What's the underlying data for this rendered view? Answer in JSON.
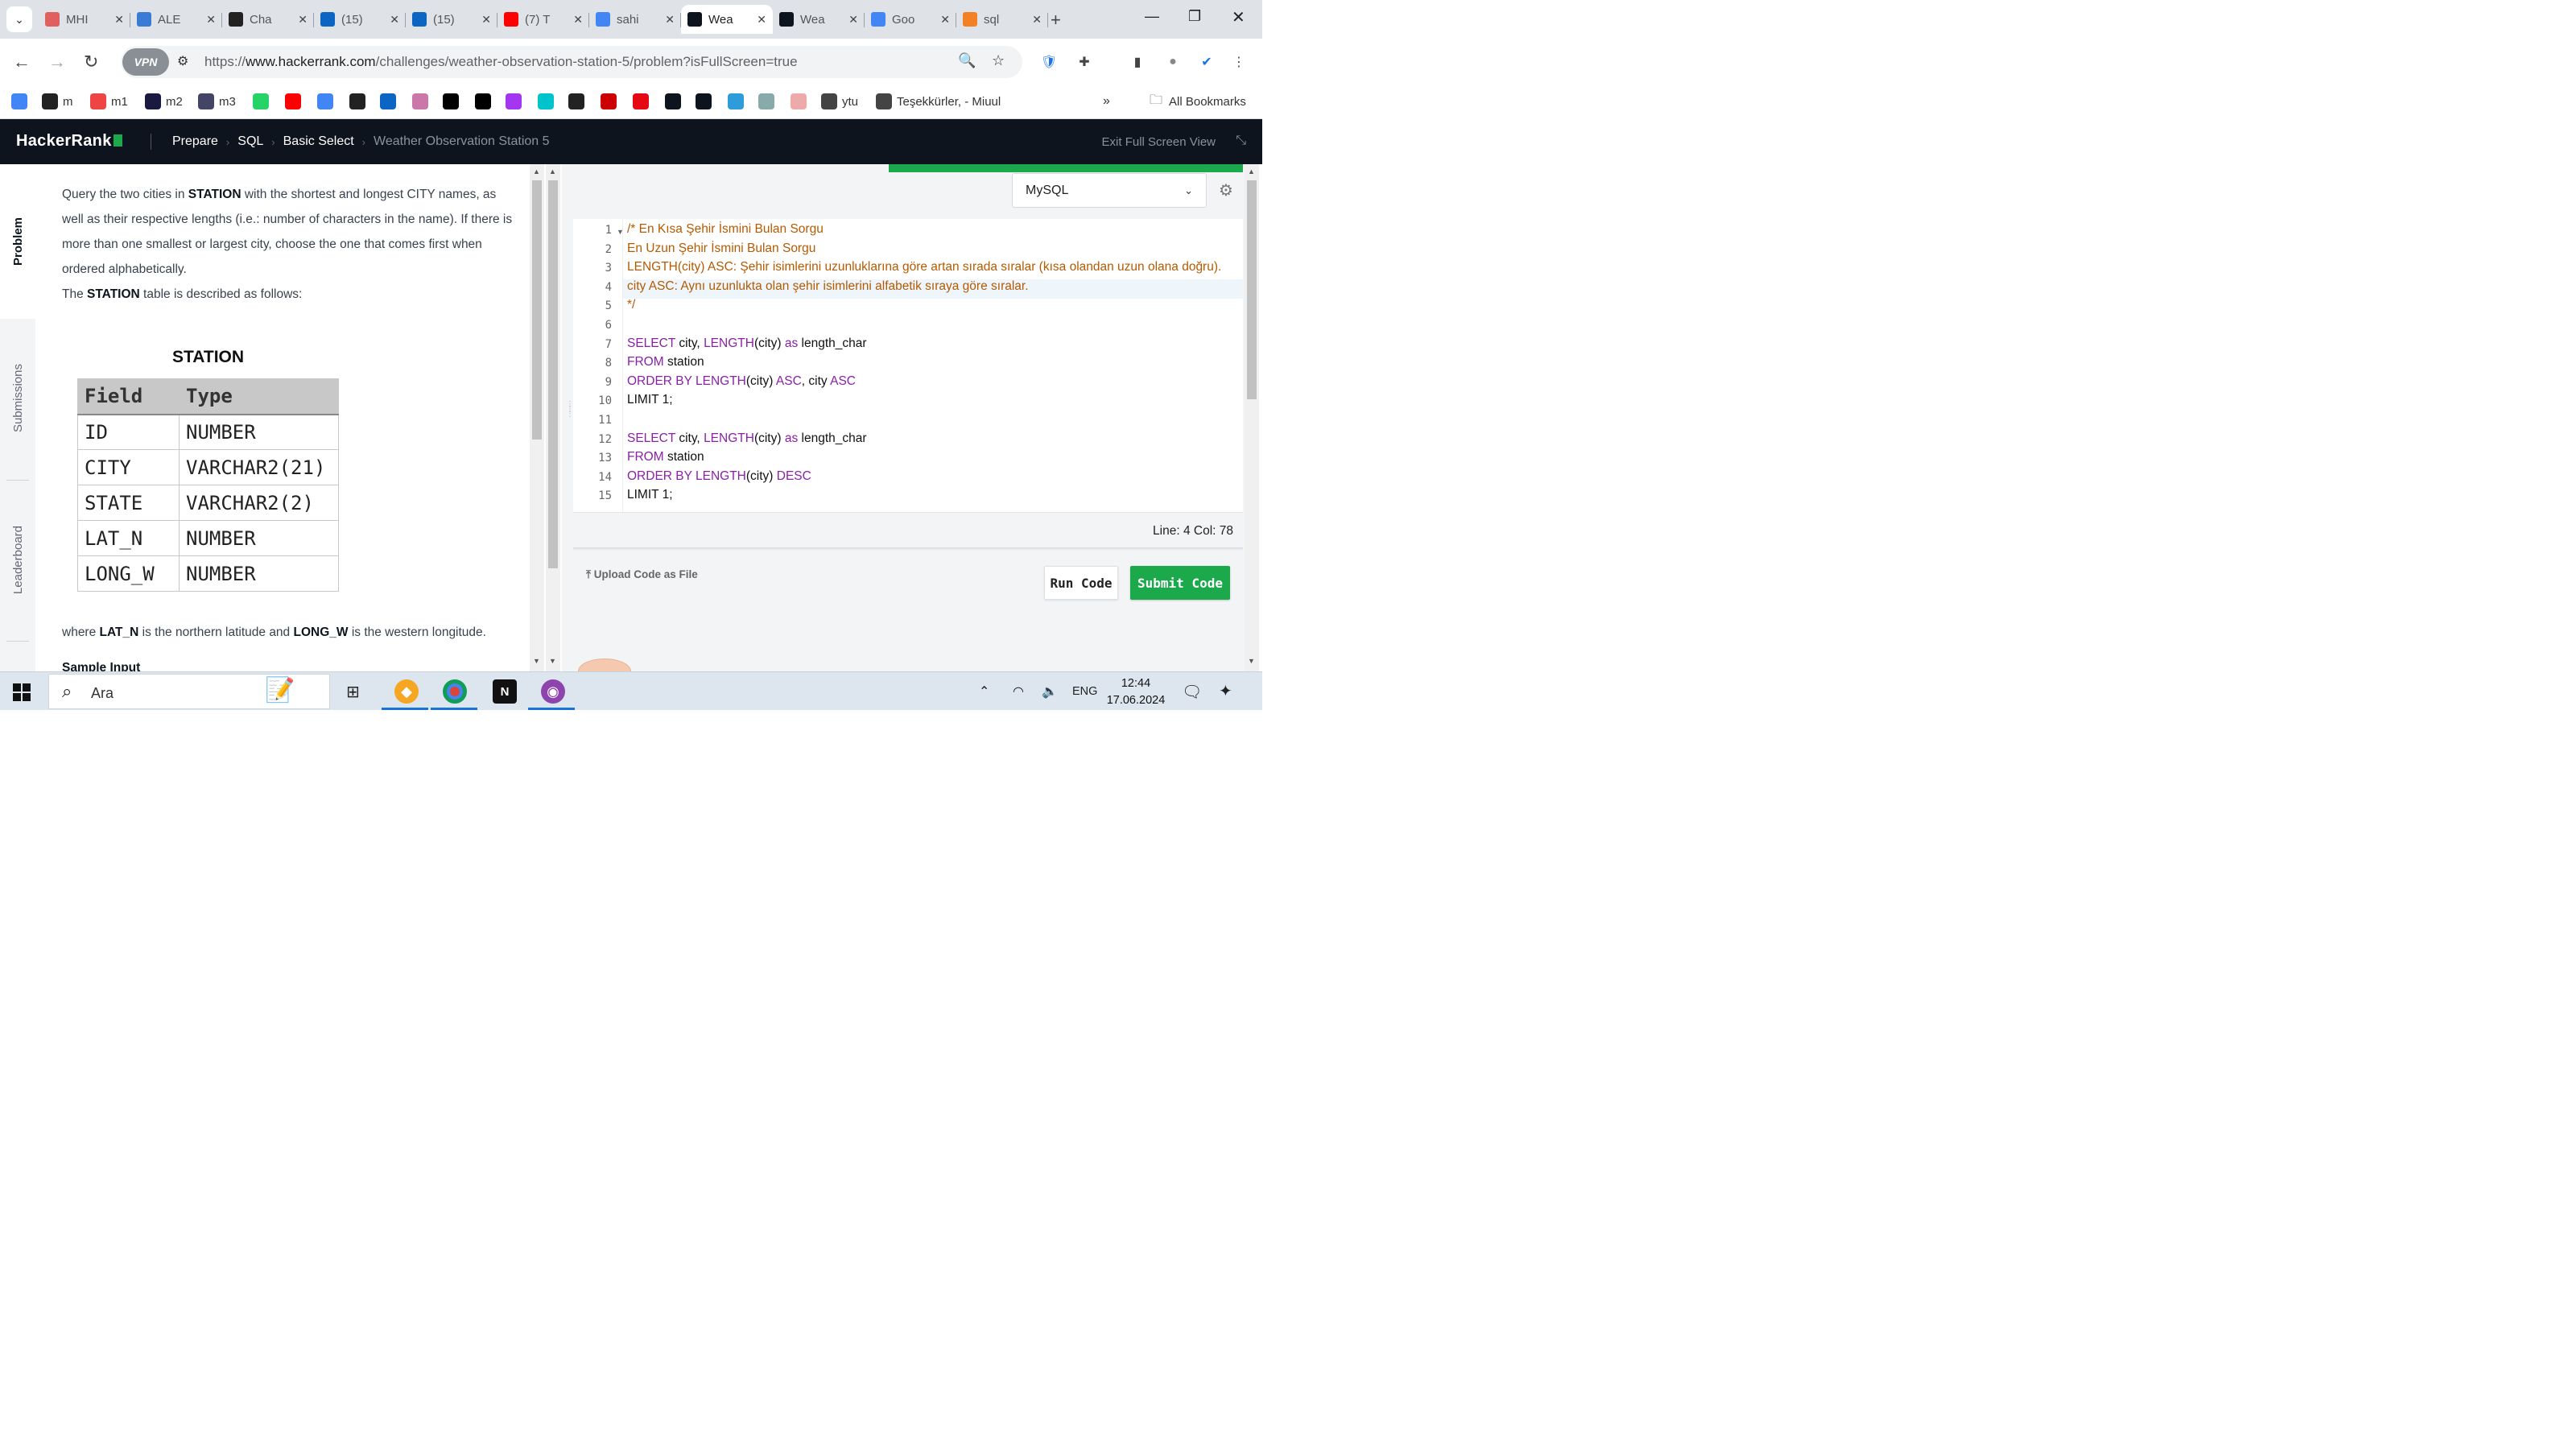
{
  "browser": {
    "tabs": [
      {
        "label": "MHI",
        "icon": "mhi-icon",
        "color": "#e06060"
      },
      {
        "label": "ALE",
        "icon": "alem-icon",
        "color": "#3a7bd5"
      },
      {
        "label": "Cha",
        "icon": "chatgpt-icon",
        "color": "#222222"
      },
      {
        "label": "(15)",
        "icon": "linkedin-icon",
        "color": "#0a66c2"
      },
      {
        "label": "(15)",
        "icon": "linkedin-icon",
        "color": "#0a66c2"
      },
      {
        "label": "(7) T",
        "icon": "youtube-icon",
        "color": "#ff0000"
      },
      {
        "label": "sahi",
        "icon": "google-icon",
        "color": "#4285f4"
      },
      {
        "label": "Wea",
        "icon": "hackerrank-icon",
        "color": "#0e141e",
        "active": true
      },
      {
        "label": "Wea",
        "icon": "hackerrank-icon",
        "color": "#0e141e"
      },
      {
        "label": "Goo",
        "icon": "google-translate-icon",
        "color": "#4285f4"
      },
      {
        "label": "sql",
        "icon": "stackoverflow-icon",
        "color": "#f48024"
      }
    ],
    "url_prefix": "https://",
    "url_host": "www.hackerrank.com",
    "url_path": "/challenges/weather-observation-station-5/problem?isFullScreen=true",
    "vpn_label": "VPN",
    "bookmarks": [
      {
        "label": "",
        "icon": "google-icon"
      },
      {
        "label": "m",
        "icon": "film-reel-icon"
      },
      {
        "label": "m1",
        "icon": "cinema-icon"
      },
      {
        "label": "m2",
        "icon": "play-icon"
      },
      {
        "label": "m3",
        "icon": "monitor-icon"
      },
      {
        "label": "",
        "icon": "whatsapp-icon"
      },
      {
        "label": "",
        "icon": "youtube-icon"
      },
      {
        "label": "",
        "icon": "translate-icon"
      },
      {
        "label": "",
        "icon": "chatgpt-icon"
      },
      {
        "label": "",
        "icon": "linkedin-icon"
      },
      {
        "label": "",
        "icon": "avatar-icon"
      },
      {
        "label": "",
        "icon": "medium-icon"
      },
      {
        "label": "",
        "icon": "unsplash-icon"
      },
      {
        "label": "",
        "icon": "udemy-icon"
      },
      {
        "label": "",
        "icon": "canva-icon"
      },
      {
        "label": "",
        "icon": "github-icon"
      },
      {
        "label": "",
        "icon": "opera-icon"
      },
      {
        "label": "",
        "icon": "netflix-icon"
      },
      {
        "label": "",
        "icon": "hackerrank-icon"
      },
      {
        "label": "",
        "icon": "hackerrank-icon"
      },
      {
        "label": "",
        "icon": "checkbox-icon"
      },
      {
        "label": "",
        "icon": "dio-icon"
      },
      {
        "label": "",
        "icon": "stack-icon"
      },
      {
        "label": "ytu",
        "icon": "globe-icon"
      },
      {
        "label": "Teşekkürler, - Miuul",
        "icon": "globe-icon"
      }
    ],
    "all_bookmarks": "All Bookmarks"
  },
  "hackerrank": {
    "logo": "HackerRank",
    "breadcrumbs": [
      "Prepare",
      "SQL",
      "Basic Select"
    ],
    "current": "Weather Observation Station 5",
    "exit_fullscreen": "Exit Full Screen View",
    "rail": [
      "Problem",
      "Submissions",
      "Leaderboard"
    ]
  },
  "problem": {
    "p1_a": "Query the two cities in ",
    "p1_b": "STATION",
    "p1_c": " with the shortest and longest CITY names, as well as their respective lengths (i.e.: number of characters in the name). If there is more than one smallest or largest city, choose the one that comes first when ordered alphabetically.",
    "p2_a": "The ",
    "p2_b": "STATION",
    "p2_c": " table is described as follows:",
    "table_title": "STATION",
    "table_headers": [
      "Field",
      "Type"
    ],
    "table_rows": [
      [
        "ID",
        "NUMBER"
      ],
      [
        "CITY",
        "VARCHAR2(21)"
      ],
      [
        "STATE",
        "VARCHAR2(2)"
      ],
      [
        "LAT_N",
        "NUMBER"
      ],
      [
        "LONG_W",
        "NUMBER"
      ]
    ],
    "p3_a": "where ",
    "p3_b": "LAT_N",
    "p3_c": " is the northern latitude and ",
    "p3_d": "LONG_W",
    "p3_e": " is the western longitude.",
    "sample_input": "Sample Input"
  },
  "editor": {
    "language": "MySQL",
    "lines": [
      {
        "n": "1",
        "text": "/* En Kısa Şehir İsmini Bulan Sorgu",
        "type": "comment"
      },
      {
        "n": "2",
        "text": "En Uzun Şehir İsmini Bulan Sorgu",
        "type": "comment"
      },
      {
        "n": "3",
        "text": "LENGTH(city) ASC: Şehir isimlerini uzunluklarına göre artan sırada sıralar (kısa olandan uzun olana doğru).",
        "type": "comment"
      },
      {
        "n": "4",
        "text": "city ASC: Aynı uzunlukta olan şehir isimlerini alfabetik sıraya göre sıralar.",
        "type": "comment"
      },
      {
        "n": "5",
        "text": "*/",
        "type": "comment"
      },
      {
        "n": "6",
        "text": "",
        "type": "code"
      },
      {
        "n": "7",
        "text": "SELECT city, LENGTH(city) as length_char",
        "type": "code"
      },
      {
        "n": "8",
        "text": "FROM station",
        "type": "code"
      },
      {
        "n": "9",
        "text": "ORDER BY LENGTH(city) ASC, city ASC",
        "type": "code"
      },
      {
        "n": "10",
        "text": "LIMIT 1;",
        "type": "code"
      },
      {
        "n": "11",
        "text": "",
        "type": "code"
      },
      {
        "n": "12",
        "text": "SELECT city, LENGTH(city) as length_char",
        "type": "code"
      },
      {
        "n": "13",
        "text": "FROM station",
        "type": "code"
      },
      {
        "n": "14",
        "text": "ORDER BY LENGTH(city) DESC",
        "type": "code"
      },
      {
        "n": "15",
        "text": "LIMIT 1;",
        "type": "code"
      }
    ],
    "status": "Line: 4 Col: 78",
    "upload": "Upload Code as File",
    "run": "Run Code",
    "submit": "Submit Code"
  },
  "taskbar": {
    "search_placeholder": "Ara",
    "lang": "ENG",
    "time": "12:44",
    "date": "17.06.2024"
  },
  "colors": {
    "brand_green": "#1ba94c",
    "header_bg": "#0e141e",
    "keyword": "#8b1fa9",
    "comment": "#b55a00"
  }
}
